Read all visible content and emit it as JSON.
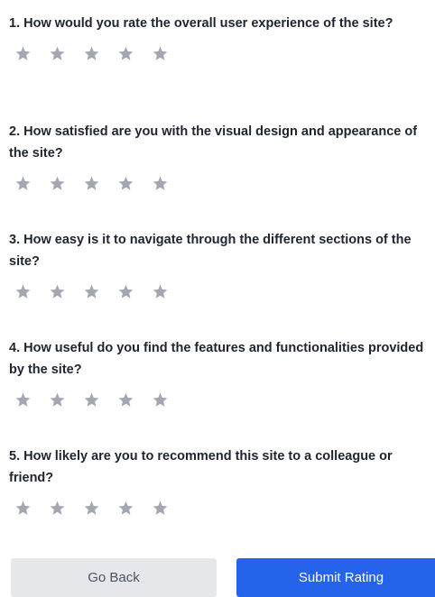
{
  "survey": {
    "questions": [
      {
        "text": "1. How would you rate the overall user experience of the site?",
        "rating": 0,
        "max_rating": 5
      },
      {
        "text": "2. How satisfied are you with the visual design and appearance of the site?",
        "rating": 0,
        "max_rating": 5
      },
      {
        "text": "3. How easy is it to navigate through the different sections of the site?",
        "rating": 0,
        "max_rating": 5
      },
      {
        "text": "4. How useful do you find the features and functionalities provided by the site?",
        "rating": 0,
        "max_rating": 5
      },
      {
        "text": "5. How likely are you to recommend this site to a colleague or friend?",
        "rating": 0,
        "max_rating": 5
      }
    ]
  },
  "actions": {
    "back_label": "Go Back",
    "submit_label": "Submit Rating"
  },
  "colors": {
    "star_empty": "#a3a8b0",
    "submit_bg": "#2563eb",
    "back_bg": "#e5e7eb"
  },
  "icons": {
    "star": "star-icon"
  }
}
